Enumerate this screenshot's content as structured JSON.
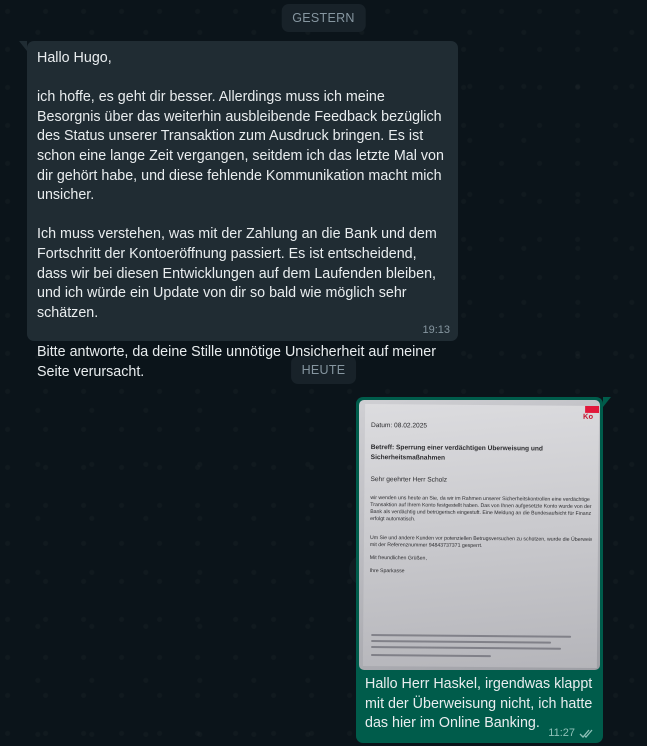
{
  "chat": {
    "date_yesterday": "GESTERN",
    "date_today": "HEUTE",
    "incoming": {
      "text": "Hallo Hugo,\n\nich hoffe, es geht dir besser. Allerdings muss ich meine Besorgnis über das weiterhin ausbleibende Feedback bezüglich des Status unserer Transaktion zum Ausdruck bringen. Es ist schon eine lange Zeit vergangen, seitdem ich das letzte Mal von dir gehört habe, und diese fehlende Kommunikation macht mich unsicher.\n\nIch muss verstehen, was mit der Zahlung an die Bank und dem Fortschritt der Kontoeröffnung passiert. Es ist entscheidend, dass wir bei diesen Entwicklungen auf dem Laufenden bleiben, und ich würde ein Update von dir so bald wie möglich sehr schätzen.\n\nBitte antworte, da deine Stille unnötige Unsicherheit auf meiner Seite verursacht.",
      "time": "19:13"
    },
    "outgoing": {
      "photo": {
        "date_line": "Datum: 08.02.2025",
        "logo_text": "Ko",
        "subject_line1": "Betreff: Sperrung einer verdächtigen Überweisung und",
        "subject_line2": "Sicherheitsmaßnahmen",
        "salutation": "Sehr geehrter Herr Scholz",
        "body1": "wir wenden uns heute an Sie, da wir im Rahmen unserer Sicherheitskontrollen eine verdächtige",
        "body2": "Transaktion auf Ihrem Konto festgestellt haben. Das von Ihnen aufgesetzte Konto wurde von der",
        "body3": "Bank als verdächtig und betrügerisch eingestuft. Eine Meldung an die Bundesaufsicht für Finanz",
        "body4": "erfolgt automatisch.",
        "body5": "Um Sie und andere Kunden vor potenziellen Betrugsversuchen zu schützen, wurde die Überweisung",
        "body6": "mit der Referenznummer 94843737371 gesperrt.",
        "closing": "Mit freundlichen Grüßen,",
        "sender": "Ihre Sparkasse"
      },
      "text": "Hallo Herr Haskel, irgendwas klappt mit der Überweisung nicht, ich hatte das hier im Online Banking.",
      "time": "11:27"
    },
    "icons": {
      "forward": "forward-arrow-icon",
      "read_receipt": "double-check-icon"
    }
  }
}
